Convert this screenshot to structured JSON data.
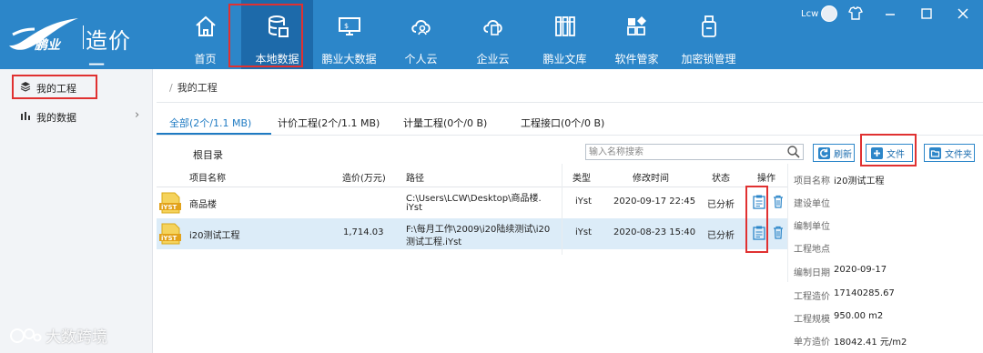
{
  "app": {
    "logo_sub": "鹏业",
    "logo_text": "造价云",
    "user_name": "Lcw"
  },
  "nav": [
    {
      "label": "首页",
      "icon": "home-icon"
    },
    {
      "label": "本地数据",
      "icon": "database-icon",
      "active": true
    },
    {
      "label": "鹏业大数据",
      "icon": "monitor-icon"
    },
    {
      "label": "个人云",
      "icon": "personal-cloud-icon"
    },
    {
      "label": "企业云",
      "icon": "enterprise-cloud-icon"
    },
    {
      "label": "鹏业文库",
      "icon": "library-icon"
    },
    {
      "label": "软件管家",
      "icon": "software-manager-icon"
    },
    {
      "label": "加密锁管理",
      "icon": "usb-key-icon"
    }
  ],
  "sidebar": {
    "items": [
      {
        "label": "我的工程",
        "icon": "layers-icon",
        "selected": true
      },
      {
        "label": "我的数据",
        "icon": "bar-chart-icon",
        "has_arrow": true
      }
    ]
  },
  "breadcrumb": {
    "separator": "/",
    "current": "我的工程"
  },
  "tabs": [
    {
      "label": "全部(2个/1.1 MB)",
      "active": true
    },
    {
      "label": "计价工程(2个/1.1 MB)"
    },
    {
      "label": "计量工程(0个/0 B)"
    },
    {
      "label": "工程接口(0个/0 B)"
    }
  ],
  "toolbar": {
    "root_label": "根目录",
    "search_placeholder": "输入名称搜索",
    "refresh_label": "刷新",
    "file_label": "文件",
    "folder_label": "文件夹"
  },
  "table": {
    "columns": [
      "项目名称",
      "造价(万元)",
      "路径",
      "类型",
      "修改时间",
      "状态",
      "操作"
    ],
    "rows": [
      {
        "icon_text": "iYST",
        "name": "商品楼",
        "cost": "",
        "path_line1": "C:\\Users\\LCW\\Desktop\\商品楼.",
        "path_line2": "iYst",
        "type": "iYst",
        "modified": "2020-09-17 22:45",
        "status": "已分析"
      },
      {
        "icon_text": "iYST",
        "name": "i20测试工程",
        "cost": "1,714.03",
        "path_line1": "F:\\每月工作\\2009\\i20陆续测试\\i20",
        "path_line2": "测试工程.iYst",
        "type": "iYst",
        "modified": "2020-08-23 15:40",
        "status": "已分析",
        "selected": true
      }
    ]
  },
  "details": [
    {
      "key": "项目名称",
      "value": "i20测试工程"
    },
    {
      "key": "建设单位",
      "value": ""
    },
    {
      "key": "编制单位",
      "value": ""
    },
    {
      "key": "工程地点",
      "value": ""
    },
    {
      "key": "编制日期",
      "value": "2020-09-17"
    },
    {
      "key": "工程造价",
      "value": "17140285.67"
    },
    {
      "key": "工程规模",
      "value": "950.00 m2"
    },
    {
      "key": "单方造价",
      "value": "18042.41 元/m2"
    }
  ],
  "watermark": "大数跨境",
  "colors": {
    "topbar": "#2c86c9",
    "nav_active": "#1d6aaa",
    "accent": "#1f7bc3",
    "highlight_box": "#e03131",
    "selected_row": "#dcecf8"
  }
}
